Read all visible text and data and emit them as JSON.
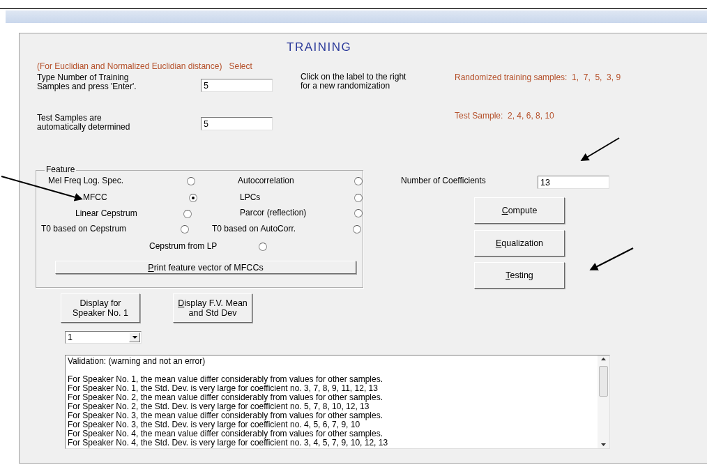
{
  "title": "TRAINING",
  "note": "(For Euclidian and Normalized Euclidian distance)   Select",
  "training": {
    "label": "Type Number of Training Samples and press 'Enter'.",
    "value": "5"
  },
  "hint": "Click on the label to the right for a new randomization",
  "randomized": "Randomized training samples:  1,  7,  5,  3, 9",
  "test": {
    "label": "Test Samples are automatically determined",
    "value": "5"
  },
  "test_samples": "Test Sample:  2, 4, 6, 8, 10",
  "feature": {
    "legend": "Feature",
    "options": [
      {
        "label": "Mel Freq Log. Spec.",
        "selected": false
      },
      {
        "label": "Autocorrelation",
        "selected": false
      },
      {
        "label": "MFCC",
        "selected": true
      },
      {
        "label": "LPCs",
        "selected": false
      },
      {
        "label": "Linear Cepstrum",
        "selected": false
      },
      {
        "label": "Parcor (reflection)",
        "selected": false
      },
      {
        "label": "T0 based on Cepstrum",
        "selected": false
      },
      {
        "label": "T0 based on AutoCorr.",
        "selected": false
      },
      {
        "label": "Cepstrum from LP",
        "selected": false
      }
    ],
    "print_button": {
      "label": "Print feature vector of MFCCs",
      "mnemonic": true
    }
  },
  "coefficients": {
    "label": "Number of Coefficients",
    "value": "13"
  },
  "actions": [
    {
      "label": "Compute",
      "mnemonic": true
    },
    {
      "label": "Equalization",
      "mnemonic": true
    },
    {
      "label": "Testing",
      "mnemonic": true
    }
  ],
  "display_buttons": [
    {
      "label": "Display for Speaker No. 1",
      "mnemonic": false
    },
    {
      "label": "Display F.V. Mean and Std Dev",
      "mnemonic": true
    }
  ],
  "speaker_select": {
    "value": "1"
  },
  "validation": [
    "Validation: (warning and not an error)",
    "For Speaker No. 1, the mean value differ considerably from values for other samples.",
    "For Speaker No. 1, the Std. Dev. is very large for coefficient no. 3, 7, 8, 9, 11, 12, 13",
    "For Speaker No. 2, the mean value differ considerably from values for other samples.",
    "For Speaker No. 2, the Std. Dev. is very large for coefficient no. 5, 7, 8, 10, 12, 13",
    "For Speaker No. 3, the mean value differ considerably from values for other samples.",
    "For Speaker No. 3, the Std. Dev. is very large for coefficient no. 4, 5, 6, 7, 9, 10",
    "For Speaker No. 4, the mean value differ considerably from values for other samples.",
    "For Speaker No. 4, the Std. Dev. is very large for coefficient no. 3, 4, 5, 7, 9, 10, 12, 13"
  ]
}
